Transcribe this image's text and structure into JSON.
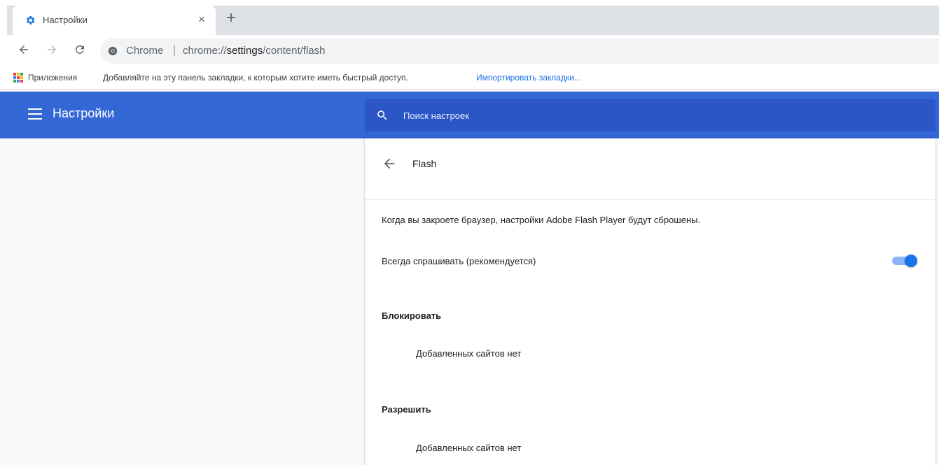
{
  "tab": {
    "title": "Настройки",
    "close": "×",
    "new_tab": "+"
  },
  "toolbar": {
    "origin": "Chrome",
    "separator": "|",
    "url_prefix": "chrome://",
    "url_host": "settings",
    "url_path": "/content/flash"
  },
  "bookmarks": {
    "apps_label": "Приложения",
    "hint": "Добавляйте на эту панель закладки, к которым хотите иметь быстрый доступ.",
    "import_link": "Импортировать закладки..."
  },
  "header": {
    "title": "Настройки",
    "search_placeholder": "Поиск настроек"
  },
  "subpage": {
    "title": "Flash",
    "description": "Когда вы закроете браузер, настройки Adobe Flash Player будут сброшены.",
    "toggle_label": "Всегда спрашивать (рекомендуется)",
    "toggle_on": true,
    "block": {
      "heading": "Блокировать",
      "empty": "Добавленных сайтов нет"
    },
    "allow": {
      "heading": "Разрешить",
      "empty": "Добавленных сайтов нет"
    }
  },
  "colors": {
    "header_bg": "#3367d6",
    "search_bg": "#2a56c6",
    "accent": "#1a73e8",
    "link": "#1a73e8"
  },
  "icons": {
    "tab_favicon": "gear-icon",
    "back": "arrow-left-icon",
    "forward": "arrow-right-icon",
    "reload": "reload-icon",
    "omnibox": "chrome-icon",
    "apps": "apps-grid-icon",
    "menu": "hamburger-icon",
    "search": "search-icon",
    "subpage_back": "arrow-left-icon"
  }
}
